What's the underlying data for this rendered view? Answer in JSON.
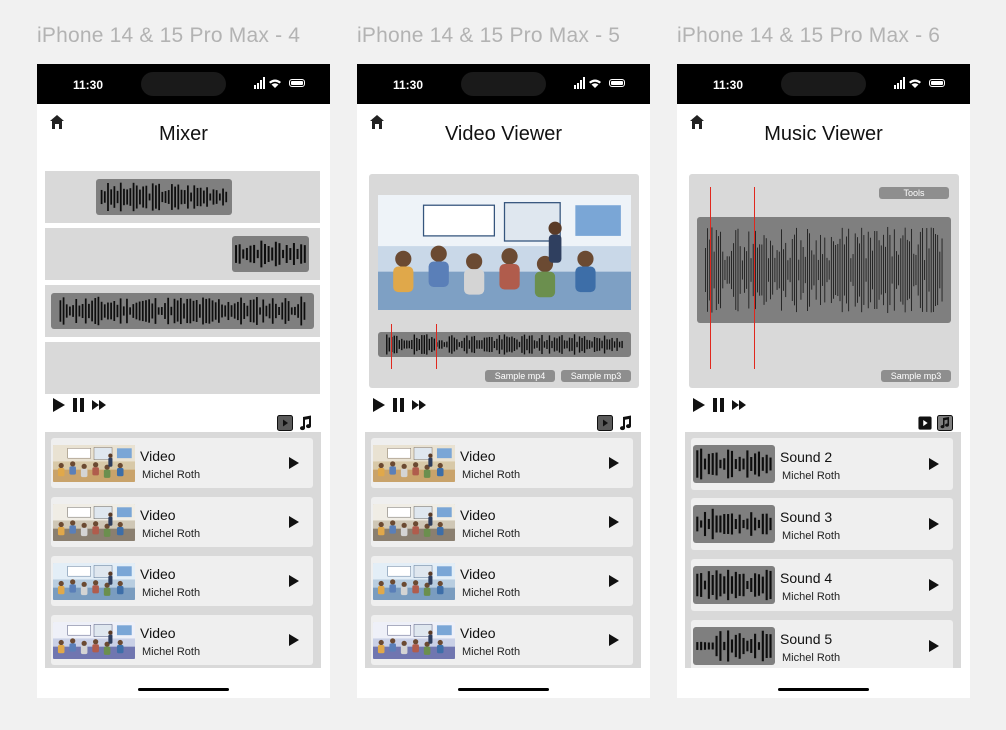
{
  "frames": [
    {
      "title": "iPhone 14 & 15 Pro Max - 4"
    },
    {
      "title": "iPhone 14 & 15 Pro Max - 5"
    },
    {
      "title": "iPhone 14 & 15 Pro Max - 6"
    }
  ],
  "status": {
    "time": "11:30"
  },
  "mixer": {
    "title": "Mixer",
    "tracks": 4,
    "list": [
      {
        "title": "Video",
        "author": "Michel Roth"
      },
      {
        "title": "Video",
        "author": "Michel Roth"
      },
      {
        "title": "Video",
        "author": "Michel Roth"
      },
      {
        "title": "Video",
        "author": "Michel Roth"
      }
    ]
  },
  "video_viewer": {
    "title": "Video Viewer",
    "chips": [
      "Sample mp4",
      "Sample mp3"
    ],
    "list": [
      {
        "title": "Video",
        "author": "Michel Roth"
      },
      {
        "title": "Video",
        "author": "Michel Roth"
      },
      {
        "title": "Video",
        "author": "Michel Roth"
      },
      {
        "title": "Video",
        "author": "Michel Roth"
      }
    ]
  },
  "music_viewer": {
    "title": "Music Viewer",
    "tools_label": "Tools",
    "chip": "Sample mp3",
    "list": [
      {
        "title": "Sound 2",
        "author": "Michel Roth"
      },
      {
        "title": "Sound 3",
        "author": "Michel Roth"
      },
      {
        "title": "Sound 4",
        "author": "Michel Roth"
      },
      {
        "title": "Sound 5",
        "author": "Michel Roth"
      }
    ]
  },
  "icons": {
    "home": "home-icon",
    "play": "play-icon",
    "pause": "pause-icon",
    "forward": "fast-forward-icon",
    "video": "video-icon",
    "music": "music-note-icon"
  },
  "colors": {
    "accent_red": "#e0281e",
    "wave_bg": "#7f7f7f",
    "panel": "#d9d9d9",
    "card": "#efefef"
  }
}
